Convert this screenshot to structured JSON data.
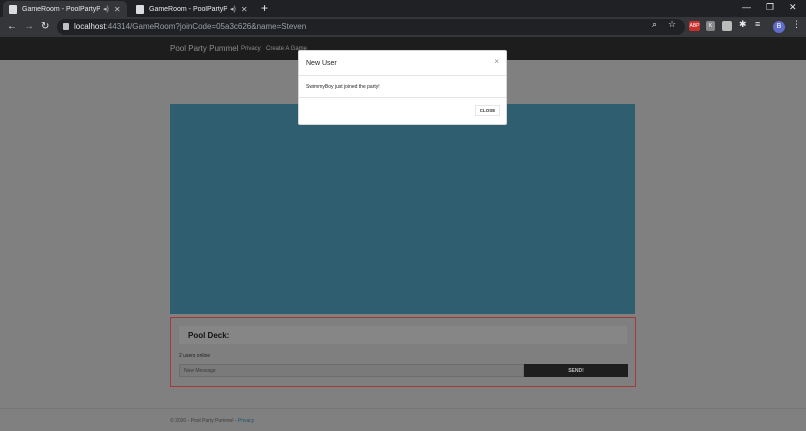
{
  "browser": {
    "tabs": [
      {
        "title": "GameRoom - PoolPartyPumr",
        "active": true
      },
      {
        "title": "GameRoom - PoolPartyPumr",
        "active": false
      }
    ],
    "url_host": "localhost",
    "url_rest": ":44314/GameRoom?joinCode=05a3c626&name=Steven",
    "ext_abp": "ABP",
    "ext_letter": "K",
    "avatar_letter": "B"
  },
  "site": {
    "brand": "Pool Party Pummel",
    "nav": [
      "Privacy",
      "Create A Game"
    ]
  },
  "deck": {
    "title": "Pool Deck:",
    "users_online": "2 users online",
    "message_placeholder": "New Message",
    "send_label": "SEND!"
  },
  "footer": {
    "text": "© 2020 - Pool Party Pummel - ",
    "privacy": "Privacy"
  },
  "modal": {
    "title": "New User",
    "close_symbol": "×",
    "message": "SwimmyBoy just joined the party!",
    "close_label": "CLOSE"
  },
  "colors": {
    "game_canvas": "#2e5e70",
    "chat_border": "#a53a3a",
    "navbar": "#1d1d1d"
  }
}
